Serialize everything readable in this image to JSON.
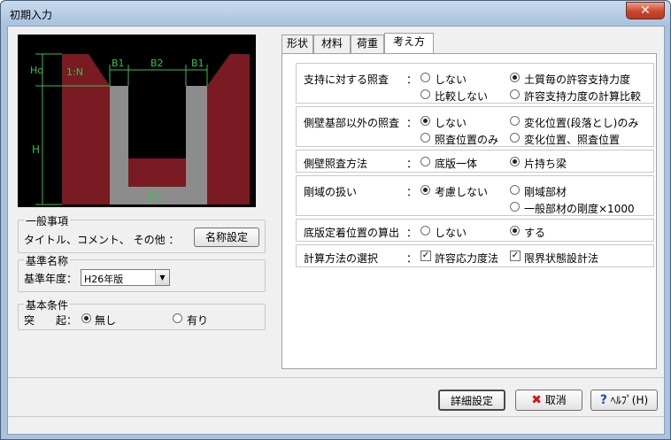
{
  "window": {
    "title": "初期入力",
    "close": "✕"
  },
  "diagram": {
    "labels": {
      "ho": "Ho",
      "h": "H",
      "slope": "1:N",
      "b1_left": "B1",
      "b2": "B2",
      "b1_right": "B1",
      "h1": "H1"
    },
    "colors": {
      "fill": "#7a1a22",
      "wall": "#8c8c8c",
      "dim": "#36c246",
      "line": "#ffffff"
    }
  },
  "general": {
    "legend": "一般事項",
    "text": "タイトル、コメント、 その他 ：",
    "button": "名称設定"
  },
  "standard": {
    "legend": "基準名称",
    "label": "基準年度：",
    "selected": "H26年版",
    "arrow": "▼"
  },
  "basic": {
    "legend": "基本条件",
    "label": "突　　起：",
    "options": [
      "無し",
      "有り"
    ],
    "selected": 0
  },
  "tabs": [
    "形状",
    "材料",
    "荷重",
    "考え方"
  ],
  "active_tab": 3,
  "settings": {
    "support": {
      "label": "支持に対する照査",
      "options": [
        "しない",
        "土質毎の許容支持力度",
        "比較しない",
        "許容支持力度の計算比較"
      ],
      "selected": 1
    },
    "side_base": {
      "label": "側壁基部以外の照査",
      "options": [
        "しない",
        "変化位置(段落とし)のみ",
        "照査位置のみ",
        "変化位置、照査位置"
      ],
      "selected": 0
    },
    "side_method": {
      "label": "側壁照査方法",
      "options": [
        "底版一体",
        "片持ち梁"
      ],
      "selected": 1
    },
    "rigid": {
      "label": "剛域の扱い",
      "options": [
        "考慮しない",
        "剛域部材",
        "一般部材の剛度×1000"
      ],
      "selected": 0
    },
    "bottom_fix": {
      "label": "底版定着位置の算出",
      "options": [
        "しない",
        "する"
      ],
      "selected": 1
    },
    "calc_method": {
      "label": "計算方法の選択",
      "options": [
        "許容応力度法",
        "限界状態設計法"
      ],
      "checked": [
        true,
        true
      ]
    },
    "colon": "："
  },
  "buttons": {
    "detail": "詳細設定",
    "cancel": "取消",
    "help": "ﾍﾙﾌﾟ(H)"
  },
  "icons": {
    "cancel": "x-icon",
    "help": "question-icon"
  },
  "colors": {
    "cancel_icon": "#d01818",
    "help_icon": "#1a52a8"
  }
}
